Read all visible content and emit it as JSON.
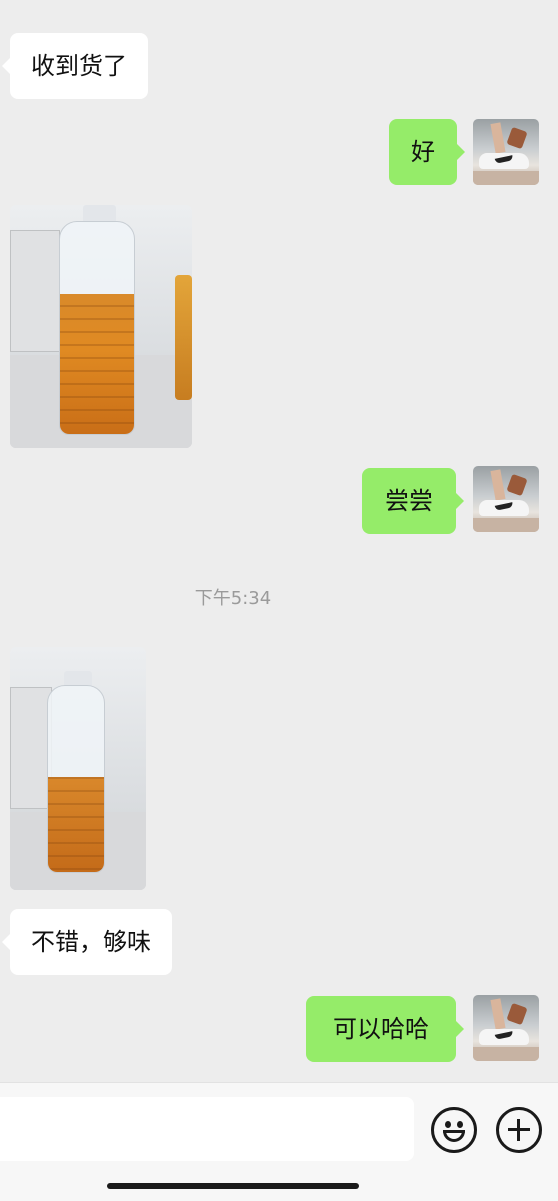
{
  "chat": {
    "messages": [
      {
        "side": "left",
        "type": "text",
        "text": "收到货了"
      },
      {
        "side": "right",
        "type": "text",
        "text": "好"
      },
      {
        "side": "left",
        "type": "image",
        "image": "photo-bottle-honey-full"
      },
      {
        "side": "right",
        "type": "text",
        "text": "尝尝"
      },
      {
        "side": "left",
        "type": "image",
        "image": "photo-bottle-honey-partial"
      },
      {
        "side": "left",
        "type": "text",
        "text": "不错，够味"
      },
      {
        "side": "right",
        "type": "text",
        "text": "可以哈哈"
      }
    ],
    "timestamp": "下午5:34"
  },
  "input_bar": {
    "placeholder": "",
    "emoji_icon": "emoji-icon",
    "plus_icon": "plus-icon"
  },
  "colors": {
    "background": "#ededed",
    "outgoing_bubble": "#95ec69",
    "incoming_bubble": "#ffffff"
  }
}
